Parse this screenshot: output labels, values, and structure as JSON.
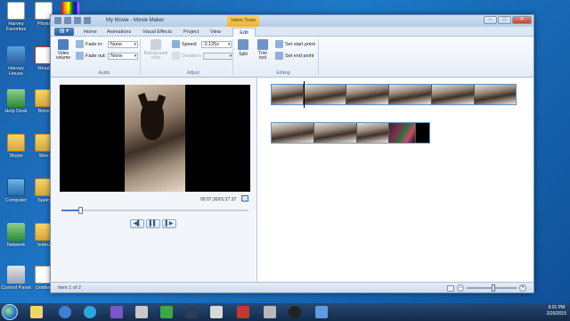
{
  "desktop": {
    "icons": [
      {
        "label": "Harvey Favorites"
      },
      {
        "label": "Photo"
      },
      {
        "label": "Harvey House"
      },
      {
        "label": "Read"
      },
      {
        "label": "Help Desk"
      },
      {
        "label": "Brine"
      },
      {
        "label": "Skype"
      },
      {
        "label": "Stev"
      },
      {
        "label": "Computer"
      },
      {
        "label": "Spelc"
      },
      {
        "label": "Network"
      },
      {
        "label": "Instru"
      },
      {
        "label": "Control Panel"
      },
      {
        "label": "Untitled"
      }
    ]
  },
  "window": {
    "title": "My Movie - Movie Maker",
    "context_tab": "Video Tools",
    "buttons": {
      "minimize": "–",
      "maximize": "□",
      "close": "✕"
    }
  },
  "tabs": {
    "file": "▤ ▾",
    "items": [
      "Home",
      "Animations",
      "Visual Effects",
      "Project",
      "View",
      "Edit"
    ],
    "active": "Edit"
  },
  "ribbon": {
    "video_volume": "Video volume",
    "fade_in_label": "Fade in:",
    "fade_in_value": "None",
    "fade_out_label": "Fade out:",
    "fade_out_value": "None",
    "audio_group": "Audio",
    "background_color": "Background color",
    "speed_label": "Speed:",
    "speed_value": "0.125x",
    "duration_label": "Duration:",
    "duration_value": "",
    "adjust_group": "Adjust",
    "split": "Split",
    "trim_tool": "Trim tool",
    "set_start_point": "Set start point",
    "set_end_point": "Set end point",
    "editing_group": "Editing"
  },
  "preview": {
    "timecode": "00:07.30/01:27.37",
    "seek_progress_fraction": 0.1,
    "controls": {
      "prev": "◀▌",
      "play": "▌▌",
      "next": "▌▶"
    }
  },
  "status": {
    "item": "Item 1 of 2",
    "zoom_minus": "−",
    "zoom_plus": "+"
  },
  "taskbar": {
    "time": "6:01 PM",
    "date": "2/26/2015"
  },
  "colors": {
    "context_tab": "#e8b33a",
    "desktop": "#1d78c8",
    "selection_border": "#6c8fbc"
  }
}
